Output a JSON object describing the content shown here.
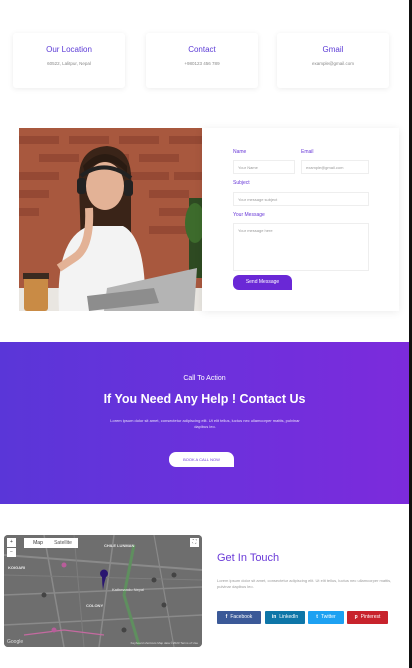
{
  "info_cards": [
    {
      "title": "Our Location",
      "value": "60522, Lalitpur, Nepal"
    },
    {
      "title": "Contact",
      "value": "+980123 456 789"
    },
    {
      "title": "Gmail",
      "value": "example@gmail.com"
    }
  ],
  "form": {
    "name_label": "Name",
    "name_placeholder": "Your Name",
    "email_label": "Email",
    "email_placeholder": "example@gmail.com",
    "subject_label": "Subject",
    "subject_placeholder": "Your message subject",
    "message_label": "Your Message",
    "message_placeholder": "Your message here",
    "send_label": "Send Message"
  },
  "cta": {
    "sub": "Call To Action",
    "title": "If You Need Any Help ! Contact Us",
    "desc": "Lorem ipsum dolor sit amet, consectetur adipiscing elit. Ut elit tellus, luctus nec ullamcorper mattis, pulvinar dapibus leo.",
    "button": "BOOK A CALL NOW"
  },
  "map": {
    "tab_map": "Map",
    "tab_satellite": "Satellite",
    "zoom_in": "+",
    "zoom_out": "−",
    "place_top": "CHILE LUNMAN",
    "place_left": "KOIGARI",
    "place_mid": "Kathmandu Nepal",
    "place_bottom": "COLONY",
    "google": "Google",
    "footer": "Keyboard shortcuts  Map data ©2023  Terms of Use"
  },
  "get_in_touch": {
    "title": "Get In Touch",
    "desc": "Lorem ipsum dolor sit amet, consectetur adipiscing elit. Ut elit tellus, luctus nec ullamcorper mattis, pulvinar dapibus leo.",
    "socials": [
      {
        "icon": "f",
        "label": "Facebook",
        "color": "#3b5998"
      },
      {
        "icon": "in",
        "label": "LinkedIn",
        "color": "#0e76a8"
      },
      {
        "icon": "t",
        "label": "Twitter",
        "color": "#1da1f2"
      },
      {
        "icon": "p",
        "label": "Pinterest",
        "color": "#c8232c"
      }
    ]
  },
  "colors": {
    "accent": "#6a3ad8",
    "cta_start": "#5a36d8",
    "cta_end": "#7c2bdc"
  }
}
